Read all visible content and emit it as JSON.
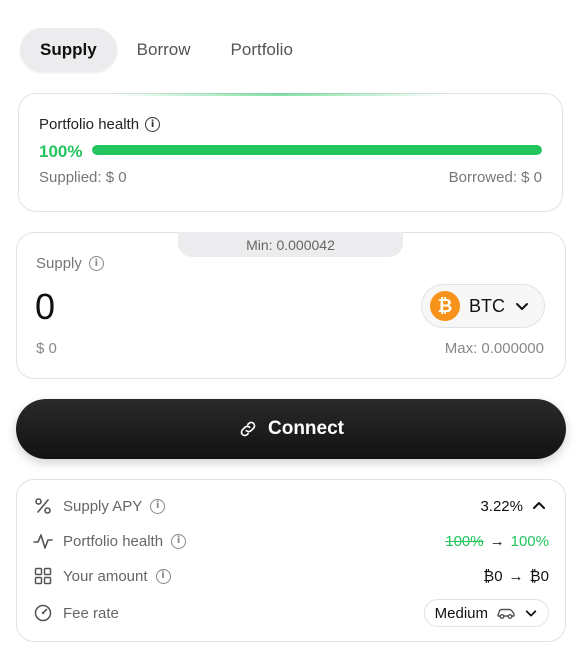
{
  "tabs": [
    {
      "label": "Supply",
      "active": true
    },
    {
      "label": "Borrow",
      "active": false
    },
    {
      "label": "Portfolio",
      "active": false
    }
  ],
  "health": {
    "title": "Portfolio health",
    "percent_text": "100%",
    "percent_value": 100,
    "supplied": "Supplied: $ 0",
    "borrowed": "Borrowed: $ 0",
    "bar_color": "#22c55e"
  },
  "supply": {
    "min_label": "Min: 0.000042",
    "label": "Supply",
    "amount": "0",
    "token": "BTC",
    "token_icon": "bitcoin-icon",
    "usd_value": "$ 0",
    "max_label": "Max: 0.000000"
  },
  "connect": {
    "label": "Connect",
    "icon": "link-icon"
  },
  "details": {
    "supply_apy": {
      "label": "Supply APY",
      "value": "3.22%"
    },
    "portfolio_health": {
      "label": "Portfolio health",
      "from": "100%",
      "arrow": "→",
      "to": "100%"
    },
    "your_amount": {
      "label": "Your amount",
      "from": "₿0",
      "arrow": "→",
      "to": "₿0"
    },
    "fee_rate": {
      "label": "Fee rate",
      "value": "Medium",
      "icon": "car-icon"
    }
  },
  "colors": {
    "accent_green": "#22c55e",
    "button_dark": "#161616",
    "bitcoin_orange": "#f7931a"
  }
}
